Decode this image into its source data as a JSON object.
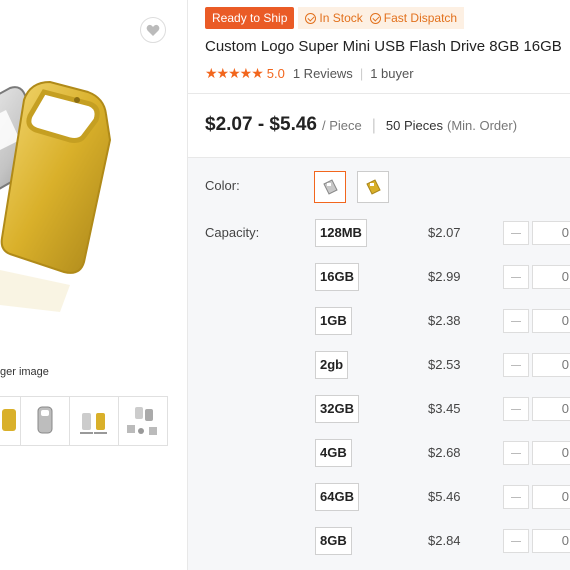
{
  "gallery": {
    "hint": "ger image",
    "thumbs": [
      "thumb-1",
      "thumb-2",
      "thumb-3",
      "thumb-4"
    ]
  },
  "badges": {
    "ready": "Ready to Ship",
    "stock": "In Stock",
    "dispatch": "Fast Dispatch"
  },
  "product": {
    "title": "Custom Logo Super Mini USB Flash Drive 8GB 16GB",
    "stars": "★★★★★",
    "score": "5.0",
    "reviews": "1 Reviews",
    "buyer": "1 buyer",
    "rating_value": 5.0
  },
  "pricing": {
    "range": "$2.07 - $5.46",
    "unit": "/ Piece",
    "moq": "50 Pieces",
    "moq_note": "(Min. Order)"
  },
  "options": {
    "color_label": "Color:",
    "capacity_label": "Capacity:",
    "colors": [
      "silver",
      "gold"
    ],
    "capacities": [
      {
        "name": "128MB",
        "price": "$2.07",
        "qty": "0"
      },
      {
        "name": "16GB",
        "price": "$2.99",
        "qty": "0"
      },
      {
        "name": "1GB",
        "price": "$2.38",
        "qty": "0"
      },
      {
        "name": "2gb",
        "price": "$2.53",
        "qty": "0"
      },
      {
        "name": "32GB",
        "price": "$3.45",
        "qty": "0"
      },
      {
        "name": "4GB",
        "price": "$2.68",
        "qty": "0"
      },
      {
        "name": "64GB",
        "price": "$5.46",
        "qty": "0"
      },
      {
        "name": "8GB",
        "price": "$2.84",
        "qty": "0"
      }
    ]
  },
  "colors": {
    "accent": "#f2661d",
    "ship_badge": "#ea5b26",
    "gold": "#d9b02a",
    "silver": "#c8c8c8"
  }
}
